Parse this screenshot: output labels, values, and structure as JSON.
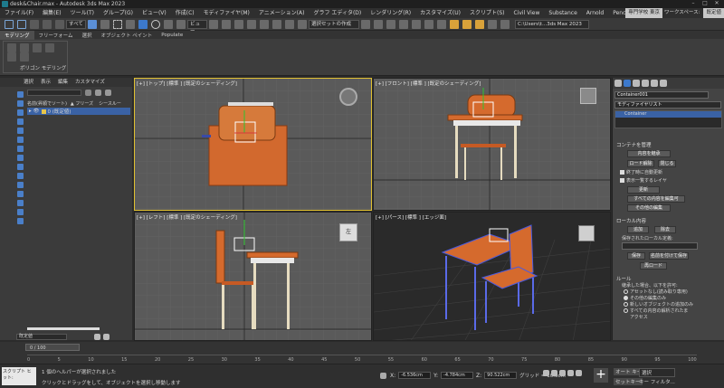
{
  "window": {
    "title": "desk&Chair.max - Autodesk 3ds Max 2023"
  },
  "menubar": {
    "items": [
      "ファイル(F)",
      "編集(E)",
      "ツール(T)",
      "グループ(G)",
      "ビュー(V)",
      "作成(C)",
      "モディファイヤ(M)",
      "アニメーション(A)",
      "グラフ エディタ(D)",
      "レンダリング(R)",
      "カスタマイズ(U)",
      "スクリプト(S)",
      "Civil View",
      "Substance",
      "Arnold",
      "Pencil+ 4"
    ],
    "workspace_user": "専門学校 東京",
    "workspace_label": "ワークスペース:",
    "workspace_value": "既定値"
  },
  "toolbar": {
    "filter_value": "すべて",
    "view_value": "ビュー",
    "selection_set_placeholder": "選択セットの作成",
    "path_value": "C:\\Users\\t...3ds Max 2023"
  },
  "ribbon": {
    "tabs": [
      "モデリング",
      "フリーフォーム",
      "選択",
      "オブジェクト ペイント",
      "Populate"
    ],
    "panel_label": "ポリゴン モデリング"
  },
  "explorer": {
    "menu": [
      "選択",
      "表示",
      "編集",
      "カスタマイズ"
    ],
    "col_name": "名前(昇順でソート)",
    "col_freeze": "▲ フリーズ",
    "col_render": "シースルー",
    "row_item": "0 (既定値)",
    "layer_value": "既定値",
    "frame_counter": "0 / 100"
  },
  "viewports": {
    "top": "[+] [トップ] [標準 ] [既定のシェーディング]",
    "front": "[+] [フロント] [標準 ] [既定のシェーディング]",
    "left": "[+] [レフト] [標準 ] [既定のシェーディング]",
    "persp": "[+] [パース] [標準 ] [エッジ面]",
    "left_navcube_label": "左"
  },
  "command_panel": {
    "object_name": "Container001",
    "modifier_list": "モディファイヤリスト",
    "stack_item": "Container",
    "section_manage": "コンテナを管理",
    "btn_contents": "内容を継承",
    "btn_load": "ロード解除",
    "btn_close": "閉じる",
    "chk_auto_update": "終了時に自動更新",
    "chk_show_list": "表示一覧するレイヤ",
    "btn_update": "更新",
    "btn_edit_all": "すべての内容を編集可",
    "btn_allow_edit": "その他の編集",
    "section_local": "ローカル内容",
    "btn_save": "追加",
    "btn_delete": "除去",
    "label_save_as": "保存されたローカル定義:",
    "btn_save2": "保存",
    "btn_saveas": "名前を付けて保存",
    "btn_reload": "再ロード",
    "section_rules": "ルール",
    "rules_text": "継承した場合、以下を許可:",
    "radio_1": "アセットなし(読み取り専用)",
    "radio_2": "その他の編集のみ",
    "radio_3": "新しいオブジェクトの追加のみ",
    "radio_4": "すべての内容の解析されたま",
    "radio_4b": "アクセス"
  },
  "timeline": {
    "ticks": [
      "0",
      "5",
      "10",
      "15",
      "20",
      "25",
      "30",
      "35",
      "40",
      "45",
      "50",
      "55",
      "60",
      "65",
      "70",
      "75",
      "80",
      "85",
      "90",
      "95",
      "100"
    ]
  },
  "status": {
    "message1": "1 個のヘルパーが選択されました",
    "message2": "クリックとドラッグをして、オブジェクトを選択し移動します",
    "script_label": "スクリプト ヒット:",
    "x_label": "X:",
    "x_value": "-6.536cm",
    "y_label": "Y:",
    "y_value": "-4.784cm",
    "z_label": "Z:",
    "z_value": "90.522cm",
    "grid_label": "グリッド = 10.0cm",
    "autokey": "オート キー",
    "setkey": "セットキー",
    "selected": "選択",
    "key_filter": "キー フィルタ..."
  }
}
